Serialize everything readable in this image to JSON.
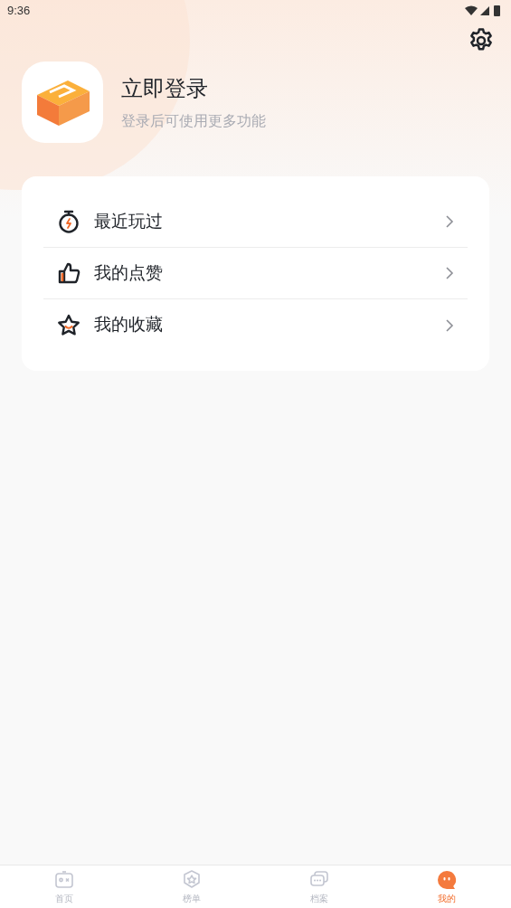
{
  "status_bar": {
    "time": "9:36"
  },
  "profile": {
    "title": "立即登录",
    "subtitle": "登录后可使用更多功能"
  },
  "menu": [
    {
      "kind": "recent",
      "label": "最近玩过"
    },
    {
      "kind": "likes",
      "label": "我的点赞"
    },
    {
      "kind": "favorites",
      "label": "我的收藏"
    }
  ],
  "tabs": [
    {
      "kind": "home",
      "label": "首页",
      "selected": false
    },
    {
      "kind": "ranking",
      "label": "榜单",
      "selected": false
    },
    {
      "kind": "archive",
      "label": "档案",
      "selected": false
    },
    {
      "kind": "mine",
      "label": "我的",
      "selected": true
    }
  ]
}
